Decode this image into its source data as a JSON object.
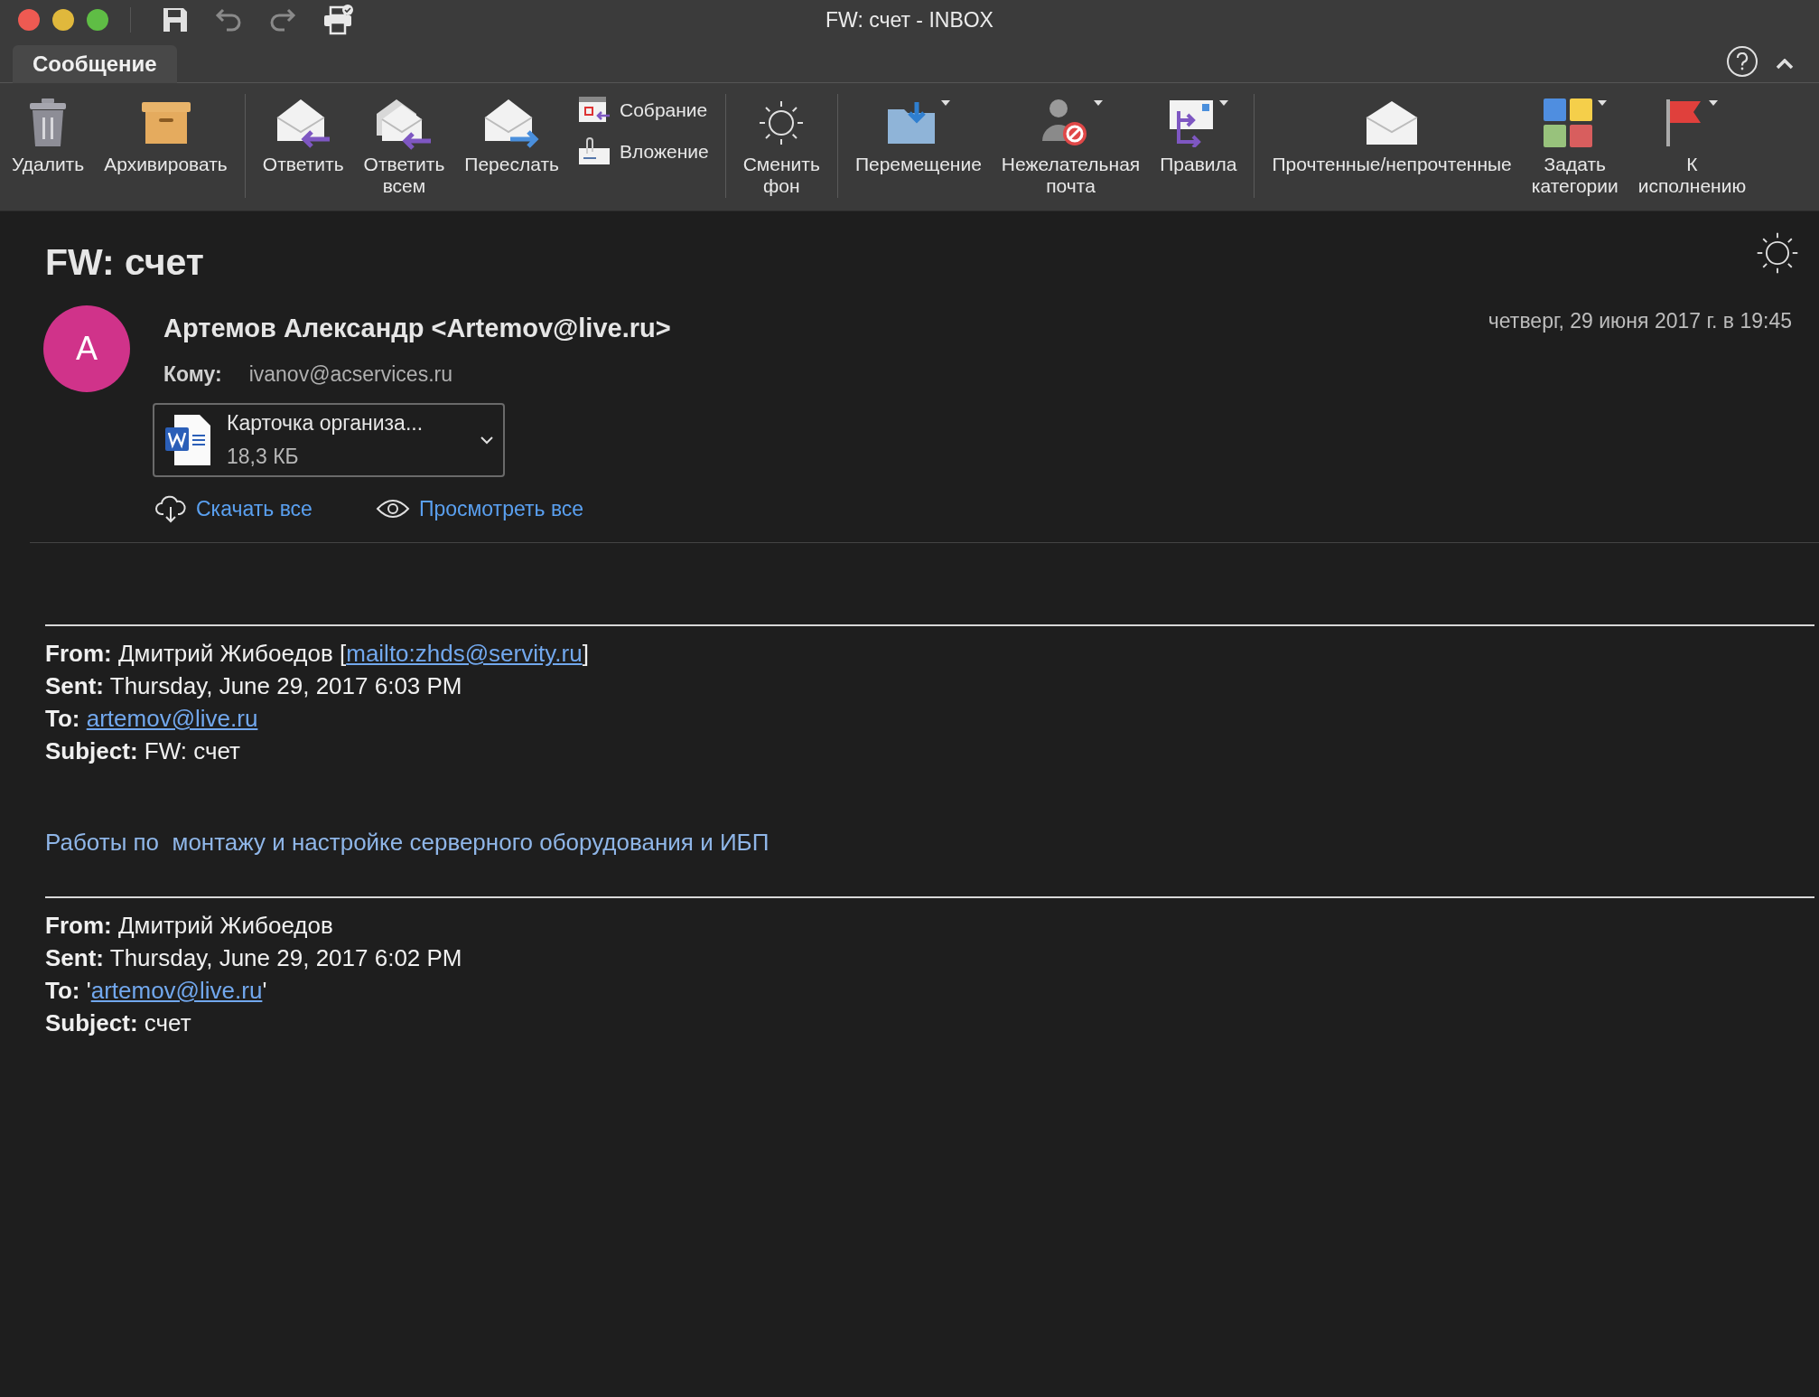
{
  "window": {
    "title": "FW: счет - INBOX"
  },
  "tabs": [
    {
      "label": "Сообщение",
      "selected": true
    }
  ],
  "ribbon": {
    "groups": [
      {
        "items": [
          {
            "kind": "large",
            "label": "Удалить",
            "dropdown": false
          },
          {
            "kind": "large",
            "label": "Архивировать",
            "dropdown": false
          }
        ]
      },
      {
        "items": [
          {
            "kind": "large",
            "label": "Ответить",
            "dropdown": false
          },
          {
            "kind": "large",
            "label": "Ответить\nвсем",
            "dropdown": false
          },
          {
            "kind": "large",
            "label": "Переслать",
            "dropdown": false
          },
          {
            "kind": "stack",
            "items": [
              {
                "label": "Собрание"
              },
              {
                "label": "Вложение"
              }
            ]
          }
        ]
      },
      {
        "items": [
          {
            "kind": "large",
            "label": "Сменить\nфон",
            "dropdown": false
          }
        ]
      },
      {
        "items": [
          {
            "kind": "large",
            "label": "Перемещение",
            "dropdown": true
          },
          {
            "kind": "large",
            "label": "Нежелательная\nпочта",
            "dropdown": true
          },
          {
            "kind": "large",
            "label": "Правила",
            "dropdown": true
          }
        ]
      },
      {
        "items": [
          {
            "kind": "large",
            "label": "Прочтенные/непрочтенные",
            "dropdown": false
          },
          {
            "kind": "large",
            "label": "Задать\nкатегории",
            "dropdown": true
          },
          {
            "kind": "large",
            "label": "К\nисполнению",
            "dropdown": true
          }
        ]
      }
    ]
  },
  "message": {
    "subject": "FW: счет",
    "avatar": {
      "letter": "A",
      "color": "#d0338a"
    },
    "sender": "Артемов Александр <Artemov@live.ru>",
    "date": "четверг, 29 июня 2017 г. в 19:45",
    "to_label": "Кому:",
    "to": "ivanov@acservices.ru",
    "attachment": {
      "name": "Карточка организа...",
      "size": "18,3 КБ"
    },
    "actions": [
      {
        "kind": "download",
        "label": "Скачать все"
      },
      {
        "kind": "preview",
        "label": "Просмотреть все"
      }
    ]
  },
  "body": [
    {
      "kind": "rule"
    },
    {
      "kind": "header",
      "lines": [
        {
          "label": "From:",
          "text": "Дмитрий Жибоедов [",
          "link": "mailto:zhds@servity.ru",
          "after": "]"
        },
        {
          "label": "Sent:",
          "text": "Thursday, June 29, 2017 6:03 PM"
        },
        {
          "label": "To:",
          "link": "artemov@live.ru"
        },
        {
          "label": "Subject:",
          "text": "FW: счет"
        }
      ]
    },
    {
      "kind": "paragraph",
      "text": "Работы по  монтажу и настройке серверного оборудования и ИБП"
    },
    {
      "kind": "rule"
    },
    {
      "kind": "header",
      "lines": [
        {
          "label": "From:",
          "text": "Дмитрий Жибоедов"
        },
        {
          "label": "Sent:",
          "text": "Thursday, June 29, 2017 6:02 PM"
        },
        {
          "label": "To:",
          "text": "'",
          "link": "artemov@live.ru",
          "after": "'"
        },
        {
          "label": "Subject:",
          "text": "счет"
        }
      ]
    }
  ]
}
